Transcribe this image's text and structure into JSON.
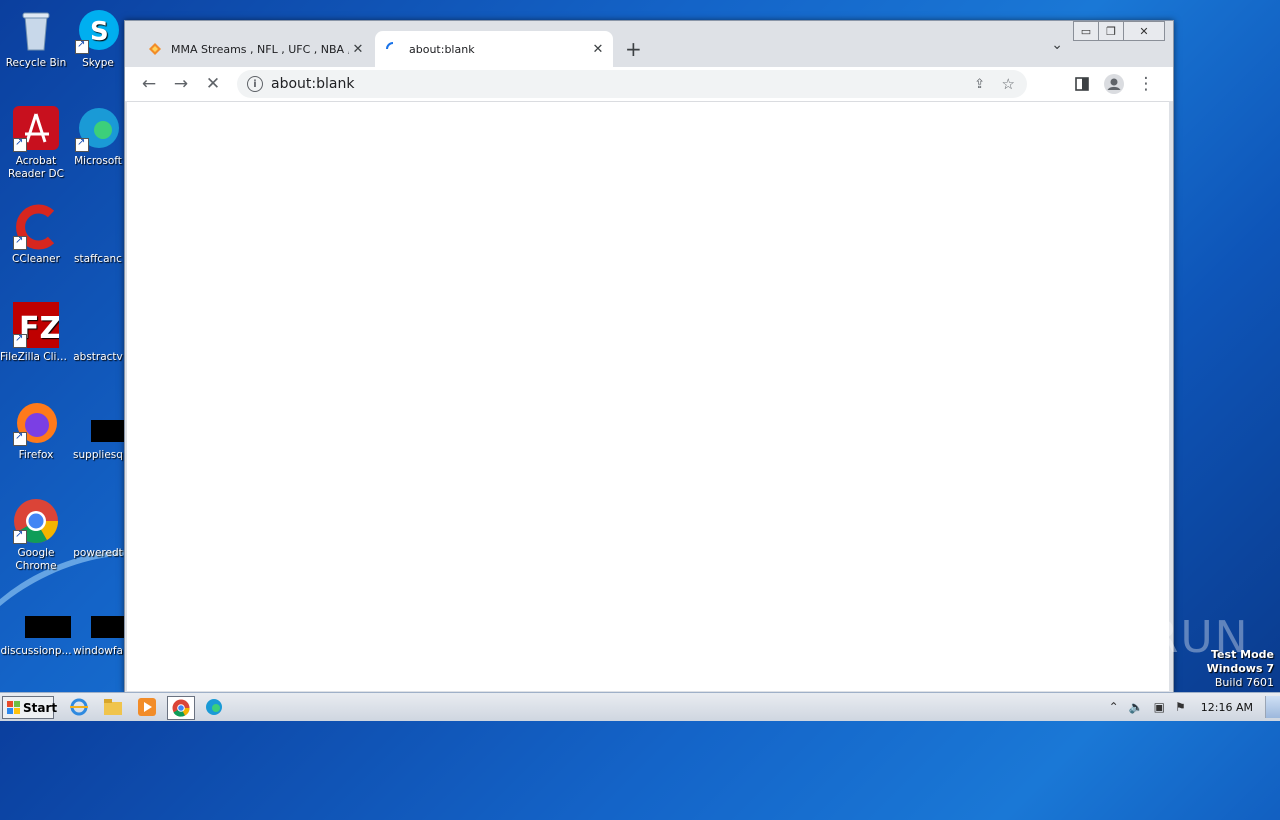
{
  "desktop": {
    "icons": [
      {
        "label": "Recycle Bin"
      },
      {
        "label": "Skype"
      },
      {
        "label": "Acrobat Reader DC"
      },
      {
        "label": "Microsoft"
      },
      {
        "label": "CCleaner"
      },
      {
        "label": "staffcanc"
      },
      {
        "label": "FileZilla Client"
      },
      {
        "label": "abstractv"
      },
      {
        "label": "Firefox"
      },
      {
        "label": "suppliesq"
      },
      {
        "label": "Google Chrome"
      },
      {
        "label": "poweredt"
      },
      {
        "label": "discussionp..."
      },
      {
        "label": "windowfa"
      }
    ]
  },
  "browser": {
    "tabs": [
      {
        "title": "MMA Streams , NFL , UFC , NBA , Bo",
        "state": "inactive"
      },
      {
        "title": "about:blank",
        "state": "active-loading"
      }
    ],
    "address": "about:blank"
  },
  "watermark": "ANY RUN",
  "test_mode": {
    "line1": "Test Mode",
    "line2": "Windows 7",
    "line3": "Build 7601"
  },
  "taskbar": {
    "start_label": "Start",
    "clock": "12:16 AM"
  },
  "colors": {
    "accent": "#1a73e8",
    "desktop": "#1464c8"
  }
}
